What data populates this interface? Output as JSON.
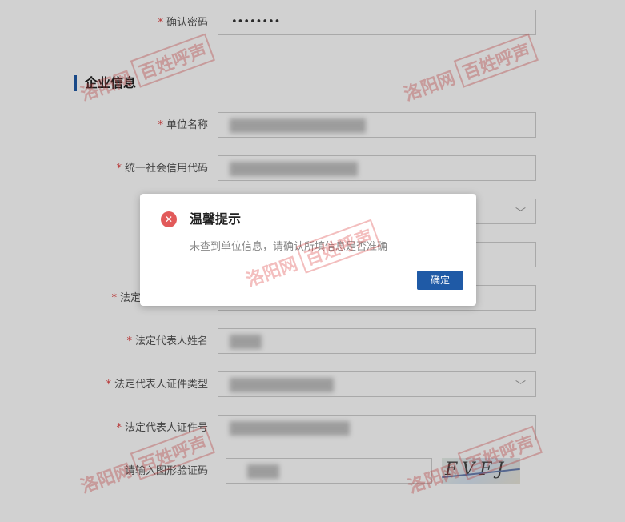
{
  "watermark": {
    "brand_script": "洛阳网",
    "brand_box": "百姓呼声"
  },
  "form": {
    "confirm_password": {
      "label": "确认密码",
      "value": "••••••••"
    },
    "section_title": "企业信息",
    "company_name": {
      "label": "单位名称"
    },
    "credit_code": {
      "label": "统一社会信用代码"
    },
    "legal_rep_prefix": {
      "label": "法定"
    },
    "legal_rep_name": {
      "label": "法定代表人姓名"
    },
    "legal_rep_id_type": {
      "label": "法定代表人证件类型"
    },
    "legal_rep_id_no": {
      "label": "法定代表人证件号"
    },
    "captcha": {
      "label": "请输入图形验证码",
      "image_text": "FVFJ"
    }
  },
  "dialog": {
    "title": "温馨提示",
    "message": "未查到单位信息，请确认所填信息是否准确",
    "confirm_label": "确定"
  },
  "colors": {
    "accent": "#1f5aa6",
    "error": "#e25a5a",
    "required": "#e04040"
  }
}
